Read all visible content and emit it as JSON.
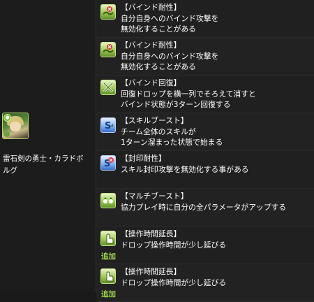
{
  "character": {
    "name_line1": "雷石剣の勇士・カラドボ",
    "name_line2": "ルグ",
    "element_icon": "wood-element-icon"
  },
  "awakenings": [
    {
      "icon": "bind-resist-icon",
      "title": "【バインド耐性】",
      "lines": [
        "自分自身へのバインド攻撃を",
        "無効化することがある"
      ],
      "added": ""
    },
    {
      "icon": "bind-resist-icon",
      "title": "【バインド耐性】",
      "lines": [
        "自分自身へのバインド攻撃を",
        "無効化することがある"
      ],
      "added": ""
    },
    {
      "icon": "bind-recover-icon",
      "title": "【バインド回復】",
      "lines": [
        "回復ドロップを横一列でそろえて消すと",
        "バインド状態が3ターン回復する"
      ],
      "added": ""
    },
    {
      "icon": "skill-boost-icon",
      "title": "【スキルブースト】",
      "lines": [
        "チーム全体のスキルが",
        "1ターン溜まった状態で始まる"
      ],
      "added": ""
    },
    {
      "icon": "seal-resist-icon",
      "title": "【封印耐性】",
      "lines": [
        "スキル封印攻撃を無効化する事がある"
      ],
      "added": ""
    },
    {
      "icon": "multi-boost-icon",
      "title": "【マルチブースト】",
      "lines": [
        "協力プレイ時に自分の全パラメータがアップする"
      ],
      "added": ""
    },
    {
      "icon": "time-extend-icon",
      "title": "【操作時間延長】",
      "lines": [
        "ドロップ操作時間が少し延びる"
      ],
      "added": "追加"
    },
    {
      "icon": "time-extend-icon",
      "title": "【操作時間延長】",
      "lines": [
        "ドロップ操作時間が少し延びる"
      ],
      "added": "追加"
    }
  ]
}
